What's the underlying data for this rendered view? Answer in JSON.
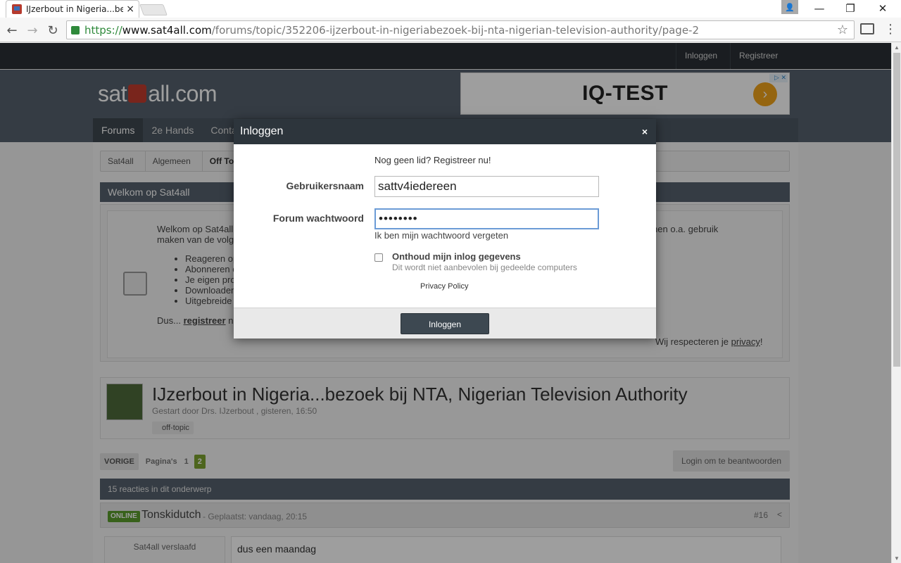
{
  "browser": {
    "tab_title": "IJzerbout in Nigeria...bezo",
    "tab_close": "×",
    "url_scheme": "https://",
    "url_host": "www.sat4all.com",
    "url_path": "/forums/topic/352206-ijzerbout-in-nigeriabezoek-bij-nta-nigerian-television-authority/page-2",
    "back": "←",
    "forward": "→",
    "reload": "↻",
    "star": "☆",
    "menu": "⋮",
    "minimize": "—",
    "restore": "❐",
    "close": "✕",
    "profile": "👤"
  },
  "site": {
    "topbar": {
      "login": "Inloggen",
      "register": "Registreer"
    },
    "logo_left": "sat",
    "logo_right": "all.com",
    "ad": {
      "text": "IQ-TEST",
      "arrow": "›",
      "adchoices": "▷ ✕"
    },
    "nav": [
      "Forums",
      "2e Hands",
      "Contact"
    ],
    "breadcrumbs": [
      "Sat4all",
      "Algemeen",
      "Off Topic"
    ],
    "welcome_title": "Welkom op Sat4all",
    "welcome_intro": "Welkom op Sat4all",
    "welcome_line2": "maken van de volg",
    "welcome_right": "en kunnen o.a. gebruik",
    "welcome_list": [
      "Reageren op",
      "Abonneren c",
      "Je eigen pro",
      "Downloaden",
      "Uitgebreide"
    ],
    "dus_prefix": "Dus...",
    "dus_link": "registreer",
    "dus_suffix": "n",
    "privacy_prefix": "Wij respecteren je",
    "privacy_link": "privacy",
    "privacy_suffix": "!",
    "topic": {
      "title": "IJzerbout in Nigeria...bezoek bij NTA, Nigerian Television Authority",
      "meta": "Gestart door Drs. IJzerbout , gisteren, 16:50",
      "tag": "off-topic"
    },
    "pager": {
      "prev": "VORIGE",
      "label": "Pagina's",
      "pages": [
        "1",
        "2"
      ],
      "current": "2"
    },
    "login_reply": "Login om te beantwoorden",
    "replies_count": "15 reacties in dit onderwerp",
    "post": {
      "status": "ONLINE",
      "author": "Tonskidutch",
      "date": "- Geplaatst: vandaag, 20:15",
      "number": "#16",
      "share": "<",
      "rank": "Sat4all verslaafd",
      "body": "dus een maandag"
    }
  },
  "modal": {
    "title": "Inloggen",
    "close": "×",
    "register_prompt": "Nog geen lid? Registreer nu!",
    "username_label": "Gebruikersnaam",
    "username_value": "sattv4iedereen",
    "password_label": "Forum wachtwoord",
    "password_value": "••••••••",
    "forgot": "Ik ben mijn wachtwoord vergeten",
    "remember_label": "Onthoud mijn inlog gegevens",
    "remember_sub": "Dit wordt niet aanbevolen bij gedeelde computers",
    "privacy": "Privacy Policy",
    "submit": "Inloggen"
  }
}
